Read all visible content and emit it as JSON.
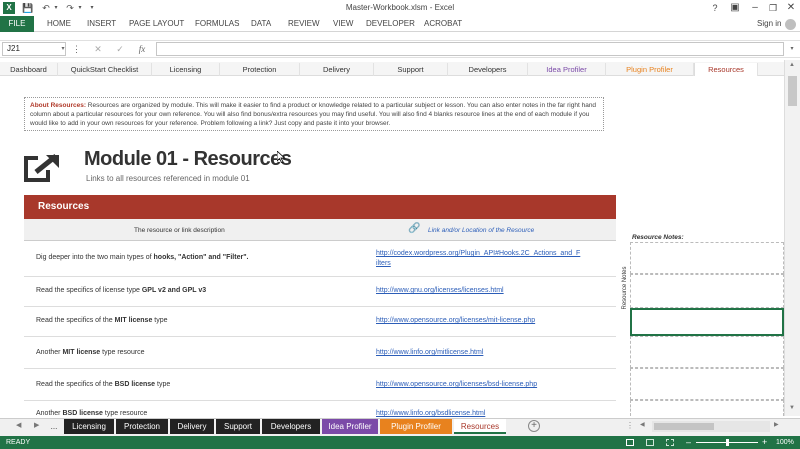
{
  "window": {
    "title": "Master-Workbook.xlsm - Excel",
    "sign_in": "Sign in"
  },
  "ribbon": {
    "file": "FILE",
    "tabs": [
      "HOME",
      "INSERT",
      "PAGE LAYOUT",
      "FORMULAS",
      "DATA",
      "REVIEW",
      "VIEW",
      "DEVELOPER",
      "ACROBAT"
    ]
  },
  "formula_bar": {
    "name_box": "J21",
    "fx": "fx",
    "formula": ""
  },
  "nav_tabs": [
    "Dashboard",
    "QuickStart Checklist",
    "Licensing",
    "Protection",
    "Delivery",
    "Support",
    "Developers",
    "Idea Profiler",
    "Plugin Profiler",
    "Resources"
  ],
  "about": {
    "label": "About Resources:",
    "text": "Resources are organized by module. This will make it easier to find a product or knowledge related to a particular subject or lesson. You can also enter notes in the far right hand column about a particular resources for your own reference. You will also find bonus/extra resources you may find useful. You will also find 4 blanks resource lines at the end of each module if you would like to add in your own resources for your reference. Problem following a  link? Just copy and paste it into your browser."
  },
  "module": {
    "title": "Module 01 - Resources",
    "subtitle": "Links to all resources referenced in module 01"
  },
  "resources": {
    "header": "Resources",
    "col_desc": "The resource or link description",
    "col_link": "Link and/or Location of the Resource",
    "notes_label": "Resource Notes:",
    "notes_side": "Resource Notes",
    "rows": [
      {
        "pre": "Dig deeper into the two main types of ",
        "bold": "hooks, \"Action\" and \"Filter\".",
        "post": "",
        "link1": "http://codex.wordpress.org/Plugin_API#Hooks.2C_Actions_and_F",
        "link2": "ilters"
      },
      {
        "pre": "Read the specifics of license type ",
        "bold": "GPL v2 and GPL v3",
        "post": "",
        "link1": "http://www.gnu.org/licenses/licenses.html",
        "link2": ""
      },
      {
        "pre": "Read the specifics of the ",
        "bold": "MIT license",
        "post": " type",
        "link1": "http://www.opensource.org/licenses/mit-license.php",
        "link2": ""
      },
      {
        "pre": "Another ",
        "bold": "MIT license",
        "post": " type resource",
        "link1": "http://www.linfo.org/mitlicense.html",
        "link2": ""
      },
      {
        "pre": "Read the specifics of the ",
        "bold": "BSD license",
        "post": " type",
        "link1": "http://www.opensource.org/licenses/bsd-license.php",
        "link2": ""
      },
      {
        "pre": "Another ",
        "bold": "BSD license",
        "post": " type resource",
        "link1": "http://www.linfo.org/bsdlicense.html",
        "link2": ""
      }
    ]
  },
  "sheet_tabs": [
    {
      "label": "...",
      "color": "#f0f0f0",
      "text": "#333"
    },
    {
      "label": "Licensing",
      "color": "#222222",
      "text": "#ffffff"
    },
    {
      "label": "Protection",
      "color": "#222222",
      "text": "#ffffff"
    },
    {
      "label": "Delivery",
      "color": "#222222",
      "text": "#ffffff"
    },
    {
      "label": "Support",
      "color": "#222222",
      "text": "#ffffff"
    },
    {
      "label": "Developers",
      "color": "#222222",
      "text": "#ffffff"
    },
    {
      "label": "Idea Profiler",
      "color": "#7b4aa8",
      "text": "#ffffff"
    },
    {
      "label": "Plugin Profiler",
      "color": "#e8821e",
      "text": "#ffffff"
    },
    {
      "label": "Resources",
      "color": "#ffffff",
      "text": "#a8382b"
    }
  ],
  "status": {
    "ready": "READY",
    "zoom": "100%"
  },
  "colors": {
    "excel_green": "#217346",
    "resources_red": "#a8382b",
    "idea_purple": "#7b4aa8",
    "plugin_orange": "#e8821e"
  }
}
